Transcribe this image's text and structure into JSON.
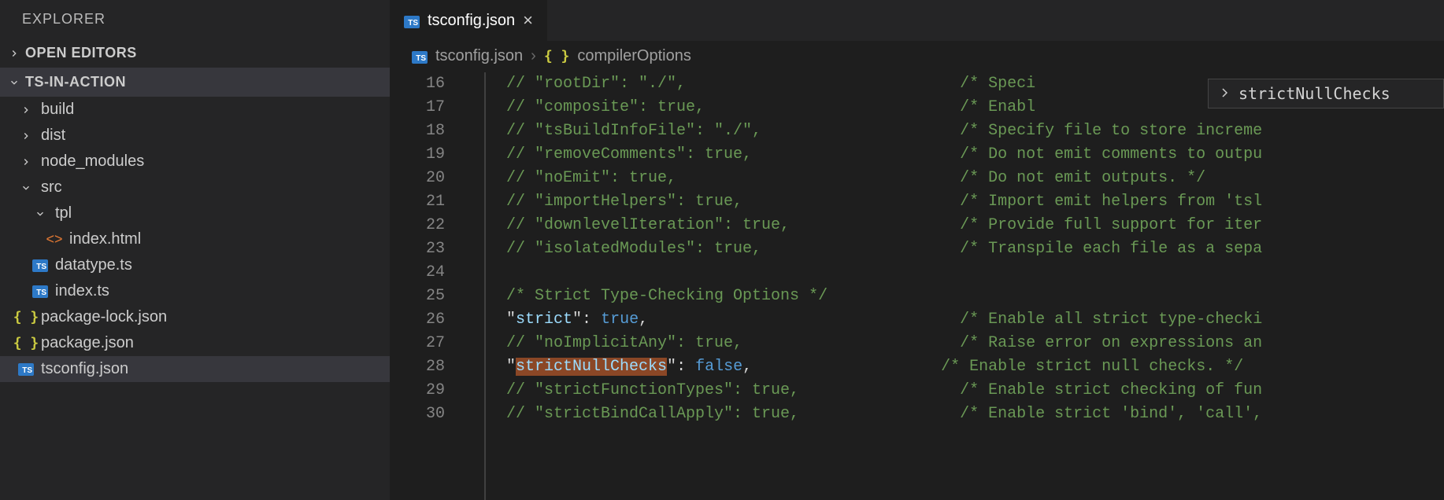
{
  "sidebar": {
    "explorer_title": "EXPLORER",
    "sections": {
      "open_editors": "OPEN EDITORS",
      "project": "TS-IN-ACTION"
    },
    "tree": [
      {
        "name": "build",
        "type": "folder",
        "indent": 0,
        "expanded": false
      },
      {
        "name": "dist",
        "type": "folder",
        "indent": 0,
        "expanded": false
      },
      {
        "name": "node_modules",
        "type": "folder",
        "indent": 0,
        "expanded": false
      },
      {
        "name": "src",
        "type": "folder",
        "indent": 0,
        "expanded": true
      },
      {
        "name": "tpl",
        "type": "folder",
        "indent": 1,
        "expanded": true
      },
      {
        "name": "index.html",
        "type": "html",
        "indent": 2
      },
      {
        "name": "datatype.ts",
        "type": "ts",
        "indent": 1
      },
      {
        "name": "index.ts",
        "type": "ts",
        "indent": 1
      },
      {
        "name": "package-lock.json",
        "type": "json",
        "indent": 0
      },
      {
        "name": "package.json",
        "type": "json",
        "indent": 0
      },
      {
        "name": "tsconfig.json",
        "type": "ts-json",
        "indent": 0,
        "selected": true
      }
    ]
  },
  "tabs": {
    "active": {
      "icon": "ts-json",
      "label": "tsconfig.json"
    }
  },
  "breadcrumb": {
    "file_icon": "ts-json",
    "file": "tsconfig.json",
    "scope_icon": "braces",
    "scope": "compilerOptions"
  },
  "suggest": {
    "label": "strictNullChecks"
  },
  "code": {
    "lines": [
      {
        "n": 16,
        "kind": "comment",
        "text": "// \"rootDir\": \"./\",",
        "trail": "/* Speci"
      },
      {
        "n": 17,
        "kind": "comment",
        "text": "// \"composite\": true,",
        "trail": "/* Enabl"
      },
      {
        "n": 18,
        "kind": "comment",
        "text": "// \"tsBuildInfoFile\": \"./\",",
        "trail": "/* Specify file to store increme"
      },
      {
        "n": 19,
        "kind": "comment",
        "text": "// \"removeComments\": true,",
        "trail": "/* Do not emit comments to outpu"
      },
      {
        "n": 20,
        "kind": "comment",
        "text": "// \"noEmit\": true,",
        "trail": "/* Do not emit outputs. */"
      },
      {
        "n": 21,
        "kind": "comment",
        "text": "// \"importHelpers\": true,",
        "trail": "/* Import emit helpers from 'tsl"
      },
      {
        "n": 22,
        "kind": "comment",
        "text": "// \"downlevelIteration\": true,",
        "trail": "/* Provide full support for iter"
      },
      {
        "n": 23,
        "kind": "comment",
        "text": "// \"isolatedModules\": true,",
        "trail": "/* Transpile each file as a sepa"
      },
      {
        "n": 24,
        "kind": "blank",
        "text": ""
      },
      {
        "n": 25,
        "kind": "section",
        "text": "/* Strict Type-Checking Options */"
      },
      {
        "n": 26,
        "kind": "prop",
        "key": "strict",
        "value": "true",
        "trail": "/* Enable all strict type-checki"
      },
      {
        "n": 27,
        "kind": "comment",
        "text": "// \"noImplicitAny\": true,",
        "trail": "/* Raise error on expressions an"
      },
      {
        "n": 28,
        "kind": "prop-hl",
        "key": "strictNullChecks",
        "value": "false",
        "trail": "/* Enable strict null checks. */"
      },
      {
        "n": 29,
        "kind": "comment",
        "text": "// \"strictFunctionTypes\": true,",
        "trail": "/* Enable strict checking of fun"
      },
      {
        "n": 30,
        "kind": "comment",
        "text": "// \"strictBindCallApply\": true,",
        "trail": "/* Enable strict 'bind', 'call',"
      }
    ]
  }
}
